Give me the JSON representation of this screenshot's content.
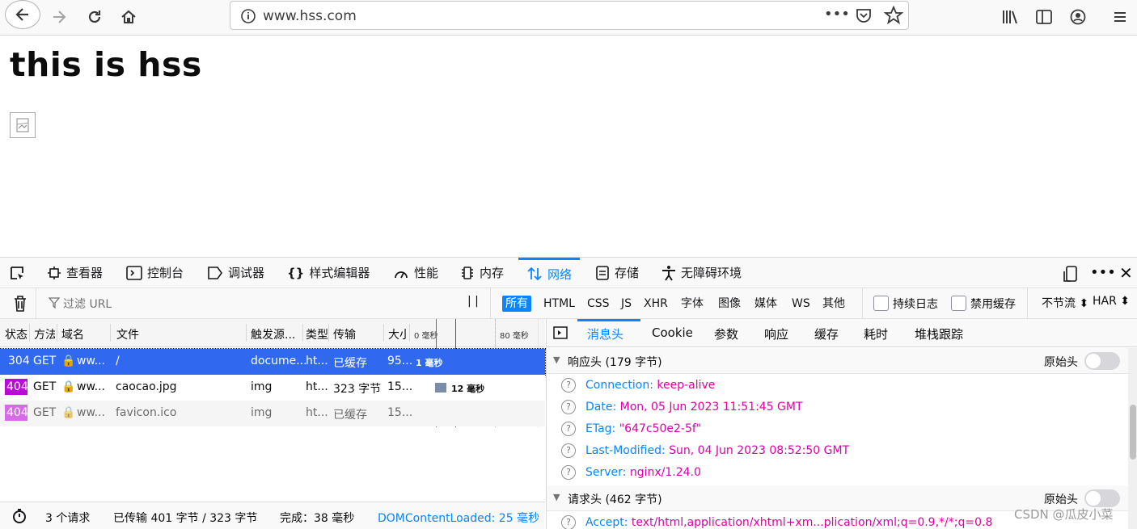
{
  "browser": {
    "url": "www.hss.com",
    "page_actions": "•••"
  },
  "page": {
    "heading": "this is hss"
  },
  "devtools": {
    "tabs": [
      {
        "label": "查看器",
        "icon": "inspector-icon"
      },
      {
        "label": "控制台",
        "icon": "console-icon"
      },
      {
        "label": "调试器",
        "icon": "debugger-icon"
      },
      {
        "label": "样式编辑器",
        "icon": "style-editor-icon"
      },
      {
        "label": "性能",
        "icon": "performance-icon"
      },
      {
        "label": "内存",
        "icon": "memory-icon"
      },
      {
        "label": "网络",
        "icon": "network-icon",
        "active": true
      },
      {
        "label": "存储",
        "icon": "storage-icon"
      },
      {
        "label": "无障碍环境",
        "icon": "accessibility-icon"
      }
    ],
    "more": "•••",
    "close": "✕",
    "net_toolbar": {
      "filter_placeholder": "过滤 URL",
      "pause": "| |",
      "filters": [
        "所有",
        "HTML",
        "CSS",
        "JS",
        "XHR",
        "字体",
        "图像",
        "媒体",
        "WS",
        "其他"
      ],
      "persist_logs": "持续日志",
      "disable_cache": "禁用缓存",
      "throttle": "不节流 ⬍",
      "har": "HAR ⬍"
    },
    "columns": [
      "状态",
      "方法",
      "域名",
      "文件",
      "触发源...",
      "类型",
      "传输",
      "大小"
    ],
    "timeline_ticks": [
      "0 毫秒",
      "80 毫秒"
    ],
    "requests": [
      {
        "status": "304",
        "method": "GET",
        "domain": "ww...",
        "file": "/",
        "cause": "docume...",
        "type": "ht...",
        "transferred": "已缓存",
        "size": "95...",
        "timing": "1 毫秒",
        "selected": true
      },
      {
        "status": "404",
        "method": "GET",
        "domain": "ww...",
        "file": "caocao.jpg",
        "cause": "img",
        "type": "ht...",
        "transferred": "323 字节",
        "size": "15...",
        "timing": "12 毫秒"
      },
      {
        "status": "404",
        "method": "GET",
        "domain": "ww...",
        "file": "favicon.ico",
        "cause": "img",
        "type": "ht...",
        "transferred": "已缓存",
        "size": "15...",
        "timing": ""
      }
    ],
    "status_bar": {
      "requests": "3 个请求",
      "transferred": "已传输 401 字节 / 323 字节",
      "finish": "完成：38 毫秒",
      "dom_loaded": "DOMContentLoaded: 25 毫秒"
    },
    "detail_tabs": [
      "消息头",
      "Cookie",
      "参数",
      "响应",
      "缓存",
      "耗时",
      "堆栈跟踪"
    ],
    "response_headers": {
      "title": "响应头 (179 字节)",
      "raw_label": "原始头",
      "items": [
        {
          "name": "Connection:",
          "value": "keep-alive"
        },
        {
          "name": "Date:",
          "value": "Mon, 05 Jun 2023 11:51:45 GMT"
        },
        {
          "name": "ETag:",
          "value": "\"647c50e2-5f\""
        },
        {
          "name": "Last-Modified:",
          "value": "Sun, 04 Jun 2023 08:52:50 GMT"
        },
        {
          "name": "Server:",
          "value": "nginx/1.24.0"
        }
      ]
    },
    "request_headers": {
      "title": "请求头 (462 字节)",
      "raw_label": "原始头",
      "first_item": {
        "name": "Accept:",
        "value": "text/html,application/xhtml+xm...plication/xml;q=0.9,*/*;q=0.8"
      }
    }
  },
  "watermark": "CSDN @瓜皮小菜",
  "colors": {
    "accent": "#0a84ff",
    "status_304": "#0a84ff",
    "status_404": "#b90bd6",
    "header_value": "#dd00a9"
  }
}
